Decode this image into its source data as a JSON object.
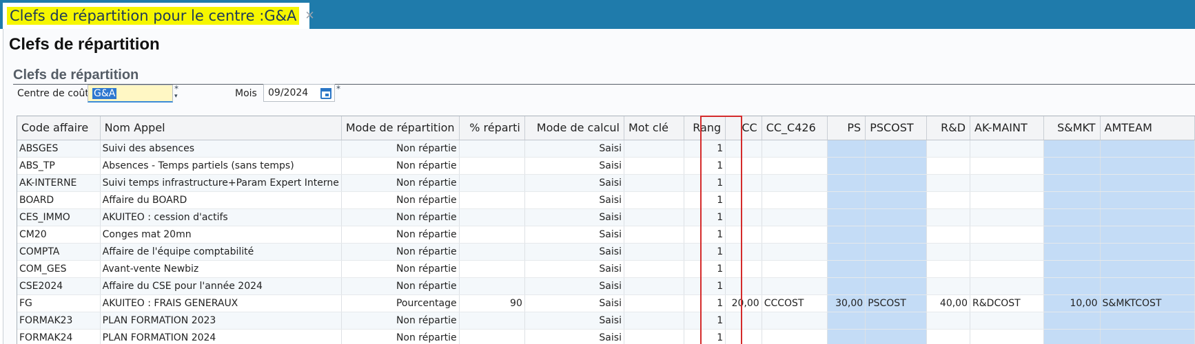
{
  "tab": {
    "title": "Clefs de répartition pour le centre :G&A",
    "close_icon": "close-icon"
  },
  "page": {
    "title": "Clefs de répartition",
    "section_title": "Clefs de répartition"
  },
  "filters": {
    "centre_label": "Centre de coût",
    "centre_value": "G&A",
    "mois_label": "Mois",
    "mois_value": "09/2024",
    "required_mark": "*"
  },
  "colors": {
    "topbar": "#1f7bab",
    "highlight": "#f6f600",
    "blue_cell": "#c4dcf6",
    "rang_box": "#d42a2a"
  },
  "grid": {
    "columns": [
      {
        "label": "Code affaire",
        "align": "l"
      },
      {
        "label": "Nom Appel",
        "align": "l"
      },
      {
        "label": "Mode de répartition",
        "align": "r"
      },
      {
        "label": "% réparti",
        "align": "r"
      },
      {
        "label": "Mode de calcul",
        "align": "r"
      },
      {
        "label": "Mot clé",
        "align": "l"
      },
      {
        "label": "Rang",
        "align": "r"
      },
      {
        "label": "CC",
        "align": "r"
      },
      {
        "label": "CC_C426",
        "align": "l"
      },
      {
        "label": "PS",
        "align": "r"
      },
      {
        "label": "PSCOST",
        "align": "l"
      },
      {
        "label": "R&D",
        "align": "r"
      },
      {
        "label": "AK-MAINT",
        "align": "l"
      },
      {
        "label": "S&MKT",
        "align": "r"
      },
      {
        "label": "AMTEAM",
        "align": "l"
      }
    ],
    "blue_columns": [
      9,
      10,
      13,
      14
    ],
    "rows": [
      [
        "ABSGES",
        "Suivi des absences",
        "Non répartie",
        "",
        "Saisi",
        "",
        "1",
        "",
        "",
        "",
        "",
        "",
        "",
        "",
        ""
      ],
      [
        "ABS_TP",
        "Absences - Temps partiels (sans temps)",
        "Non répartie",
        "",
        "Saisi",
        "",
        "1",
        "",
        "",
        "",
        "",
        "",
        "",
        "",
        ""
      ],
      [
        "AK-INTERNE",
        "Suivi temps infrastructure+Param Expert Interne",
        "Non répartie",
        "",
        "Saisi",
        "",
        "1",
        "",
        "",
        "",
        "",
        "",
        "",
        "",
        ""
      ],
      [
        "BOARD",
        "Affaire du BOARD",
        "Non répartie",
        "",
        "Saisi",
        "",
        "1",
        "",
        "",
        "",
        "",
        "",
        "",
        "",
        ""
      ],
      [
        "CES_IMMO",
        "AKUITEO : cession d'actifs",
        "Non répartie",
        "",
        "Saisi",
        "",
        "1",
        "",
        "",
        "",
        "",
        "",
        "",
        "",
        ""
      ],
      [
        "CM20",
        "Conges mat 20mn",
        "Non répartie",
        "",
        "Saisi",
        "",
        "1",
        "",
        "",
        "",
        "",
        "",
        "",
        "",
        ""
      ],
      [
        "COMPTA",
        "Affaire de l'équipe comptabilité",
        "Non répartie",
        "",
        "Saisi",
        "",
        "1",
        "",
        "",
        "",
        "",
        "",
        "",
        "",
        ""
      ],
      [
        "COM_GES",
        "Avant-vente Newbiz",
        "Non répartie",
        "",
        "Saisi",
        "",
        "1",
        "",
        "",
        "",
        "",
        "",
        "",
        "",
        ""
      ],
      [
        "CSE2024",
        "Affaire du CSE pour l'année 2024",
        "Non répartie",
        "",
        "Saisi",
        "",
        "1",
        "",
        "",
        "",
        "",
        "",
        "",
        "",
        ""
      ],
      [
        "FG",
        "AKUITEO : FRAIS GENERAUX",
        "Pourcentage",
        "90",
        "Saisi",
        "",
        "1",
        "20,00",
        "CCCOST",
        "30,00",
        "PSCOST",
        "40,00",
        "R&DCOST",
        "10,00",
        "S&MKTCOST"
      ],
      [
        "FORMAK23",
        "PLAN FORMATION 2023",
        "Non répartie",
        "",
        "Saisi",
        "",
        "1",
        "",
        "",
        "",
        "",
        "",
        "",
        "",
        ""
      ],
      [
        "FORMAK24",
        "PLAN FORMATION 2024",
        "Non répartie",
        "",
        "Saisi",
        "",
        "1",
        "",
        "",
        "",
        "",
        "",
        "",
        "",
        ""
      ]
    ]
  }
}
